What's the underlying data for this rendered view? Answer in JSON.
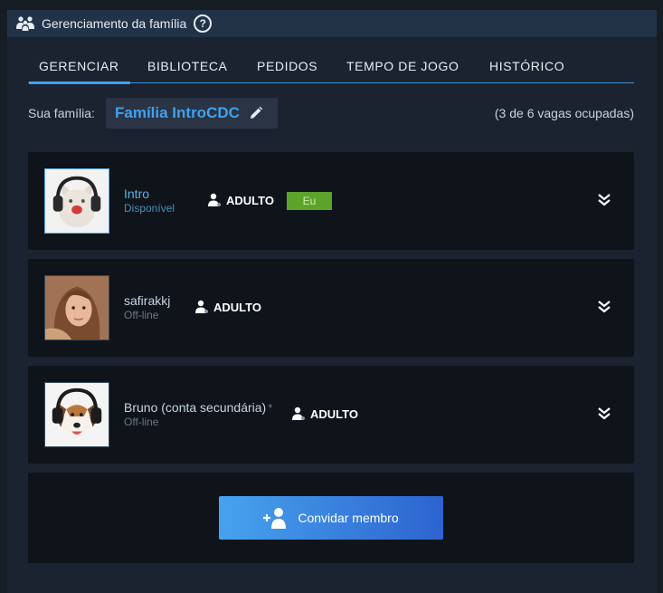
{
  "header": {
    "title": "Gerenciamento da família",
    "help_label": "?"
  },
  "tabs": [
    {
      "label": "GERENCIAR",
      "active": true
    },
    {
      "label": "BIBLIOTECA",
      "active": false
    },
    {
      "label": "PEDIDOS",
      "active": false
    },
    {
      "label": "TEMPO DE JOGO",
      "active": false
    },
    {
      "label": "HISTÓRICO",
      "active": false
    }
  ],
  "family": {
    "label": "Sua família:",
    "name": "Família IntroCDC",
    "slots": "(3 de 6 vagas ocupadas)"
  },
  "members": [
    {
      "name": "Intro",
      "status": "Disponível",
      "role": "ADULTO",
      "badge": "Eu",
      "online": true
    },
    {
      "name": "safirakkj",
      "status": "Off-line",
      "role": "ADULTO",
      "online": false
    },
    {
      "name": "Bruno (conta secundária)",
      "asterisk": "*",
      "status": "Off-line",
      "role": "ADULTO",
      "online": false
    }
  ],
  "invite": {
    "label": "Convidar membro"
  },
  "colors": {
    "accent": "#3fa2f0",
    "badge_green": "#5ba32b",
    "panel": "#1b2330",
    "card": "#0f141b"
  }
}
